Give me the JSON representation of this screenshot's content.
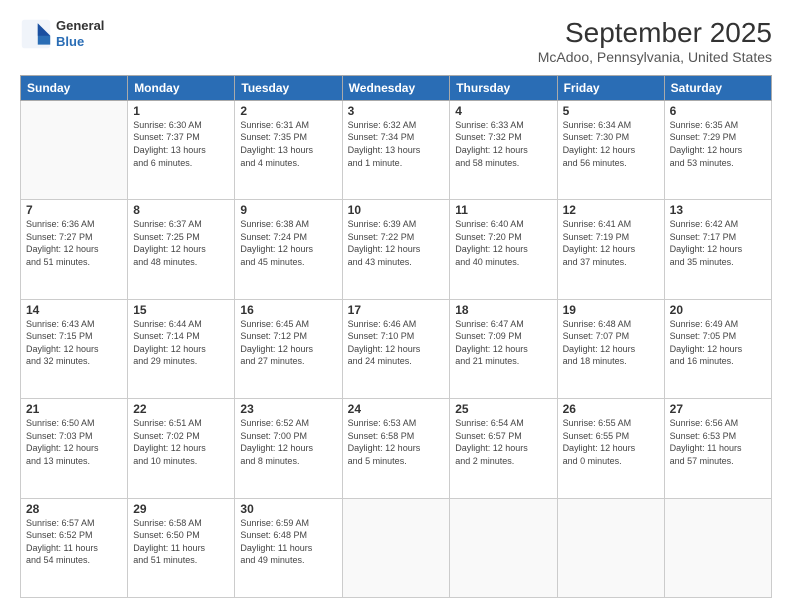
{
  "header": {
    "logo_line1": "General",
    "logo_line2": "Blue",
    "title": "September 2025",
    "subtitle": "McAdoo, Pennsylvania, United States"
  },
  "weekdays": [
    "Sunday",
    "Monday",
    "Tuesday",
    "Wednesday",
    "Thursday",
    "Friday",
    "Saturday"
  ],
  "weeks": [
    [
      {
        "day": "",
        "info": ""
      },
      {
        "day": "1",
        "info": "Sunrise: 6:30 AM\nSunset: 7:37 PM\nDaylight: 13 hours\nand 6 minutes."
      },
      {
        "day": "2",
        "info": "Sunrise: 6:31 AM\nSunset: 7:35 PM\nDaylight: 13 hours\nand 4 minutes."
      },
      {
        "day": "3",
        "info": "Sunrise: 6:32 AM\nSunset: 7:34 PM\nDaylight: 13 hours\nand 1 minute."
      },
      {
        "day": "4",
        "info": "Sunrise: 6:33 AM\nSunset: 7:32 PM\nDaylight: 12 hours\nand 58 minutes."
      },
      {
        "day": "5",
        "info": "Sunrise: 6:34 AM\nSunset: 7:30 PM\nDaylight: 12 hours\nand 56 minutes."
      },
      {
        "day": "6",
        "info": "Sunrise: 6:35 AM\nSunset: 7:29 PM\nDaylight: 12 hours\nand 53 minutes."
      }
    ],
    [
      {
        "day": "7",
        "info": "Sunrise: 6:36 AM\nSunset: 7:27 PM\nDaylight: 12 hours\nand 51 minutes."
      },
      {
        "day": "8",
        "info": "Sunrise: 6:37 AM\nSunset: 7:25 PM\nDaylight: 12 hours\nand 48 minutes."
      },
      {
        "day": "9",
        "info": "Sunrise: 6:38 AM\nSunset: 7:24 PM\nDaylight: 12 hours\nand 45 minutes."
      },
      {
        "day": "10",
        "info": "Sunrise: 6:39 AM\nSunset: 7:22 PM\nDaylight: 12 hours\nand 43 minutes."
      },
      {
        "day": "11",
        "info": "Sunrise: 6:40 AM\nSunset: 7:20 PM\nDaylight: 12 hours\nand 40 minutes."
      },
      {
        "day": "12",
        "info": "Sunrise: 6:41 AM\nSunset: 7:19 PM\nDaylight: 12 hours\nand 37 minutes."
      },
      {
        "day": "13",
        "info": "Sunrise: 6:42 AM\nSunset: 7:17 PM\nDaylight: 12 hours\nand 35 minutes."
      }
    ],
    [
      {
        "day": "14",
        "info": "Sunrise: 6:43 AM\nSunset: 7:15 PM\nDaylight: 12 hours\nand 32 minutes."
      },
      {
        "day": "15",
        "info": "Sunrise: 6:44 AM\nSunset: 7:14 PM\nDaylight: 12 hours\nand 29 minutes."
      },
      {
        "day": "16",
        "info": "Sunrise: 6:45 AM\nSunset: 7:12 PM\nDaylight: 12 hours\nand 27 minutes."
      },
      {
        "day": "17",
        "info": "Sunrise: 6:46 AM\nSunset: 7:10 PM\nDaylight: 12 hours\nand 24 minutes."
      },
      {
        "day": "18",
        "info": "Sunrise: 6:47 AM\nSunset: 7:09 PM\nDaylight: 12 hours\nand 21 minutes."
      },
      {
        "day": "19",
        "info": "Sunrise: 6:48 AM\nSunset: 7:07 PM\nDaylight: 12 hours\nand 18 minutes."
      },
      {
        "day": "20",
        "info": "Sunrise: 6:49 AM\nSunset: 7:05 PM\nDaylight: 12 hours\nand 16 minutes."
      }
    ],
    [
      {
        "day": "21",
        "info": "Sunrise: 6:50 AM\nSunset: 7:03 PM\nDaylight: 12 hours\nand 13 minutes."
      },
      {
        "day": "22",
        "info": "Sunrise: 6:51 AM\nSunset: 7:02 PM\nDaylight: 12 hours\nand 10 minutes."
      },
      {
        "day": "23",
        "info": "Sunrise: 6:52 AM\nSunset: 7:00 PM\nDaylight: 12 hours\nand 8 minutes."
      },
      {
        "day": "24",
        "info": "Sunrise: 6:53 AM\nSunset: 6:58 PM\nDaylight: 12 hours\nand 5 minutes."
      },
      {
        "day": "25",
        "info": "Sunrise: 6:54 AM\nSunset: 6:57 PM\nDaylight: 12 hours\nand 2 minutes."
      },
      {
        "day": "26",
        "info": "Sunrise: 6:55 AM\nSunset: 6:55 PM\nDaylight: 12 hours\nand 0 minutes."
      },
      {
        "day": "27",
        "info": "Sunrise: 6:56 AM\nSunset: 6:53 PM\nDaylight: 11 hours\nand 57 minutes."
      }
    ],
    [
      {
        "day": "28",
        "info": "Sunrise: 6:57 AM\nSunset: 6:52 PM\nDaylight: 11 hours\nand 54 minutes."
      },
      {
        "day": "29",
        "info": "Sunrise: 6:58 AM\nSunset: 6:50 PM\nDaylight: 11 hours\nand 51 minutes."
      },
      {
        "day": "30",
        "info": "Sunrise: 6:59 AM\nSunset: 6:48 PM\nDaylight: 11 hours\nand 49 minutes."
      },
      {
        "day": "",
        "info": ""
      },
      {
        "day": "",
        "info": ""
      },
      {
        "day": "",
        "info": ""
      },
      {
        "day": "",
        "info": ""
      }
    ]
  ]
}
